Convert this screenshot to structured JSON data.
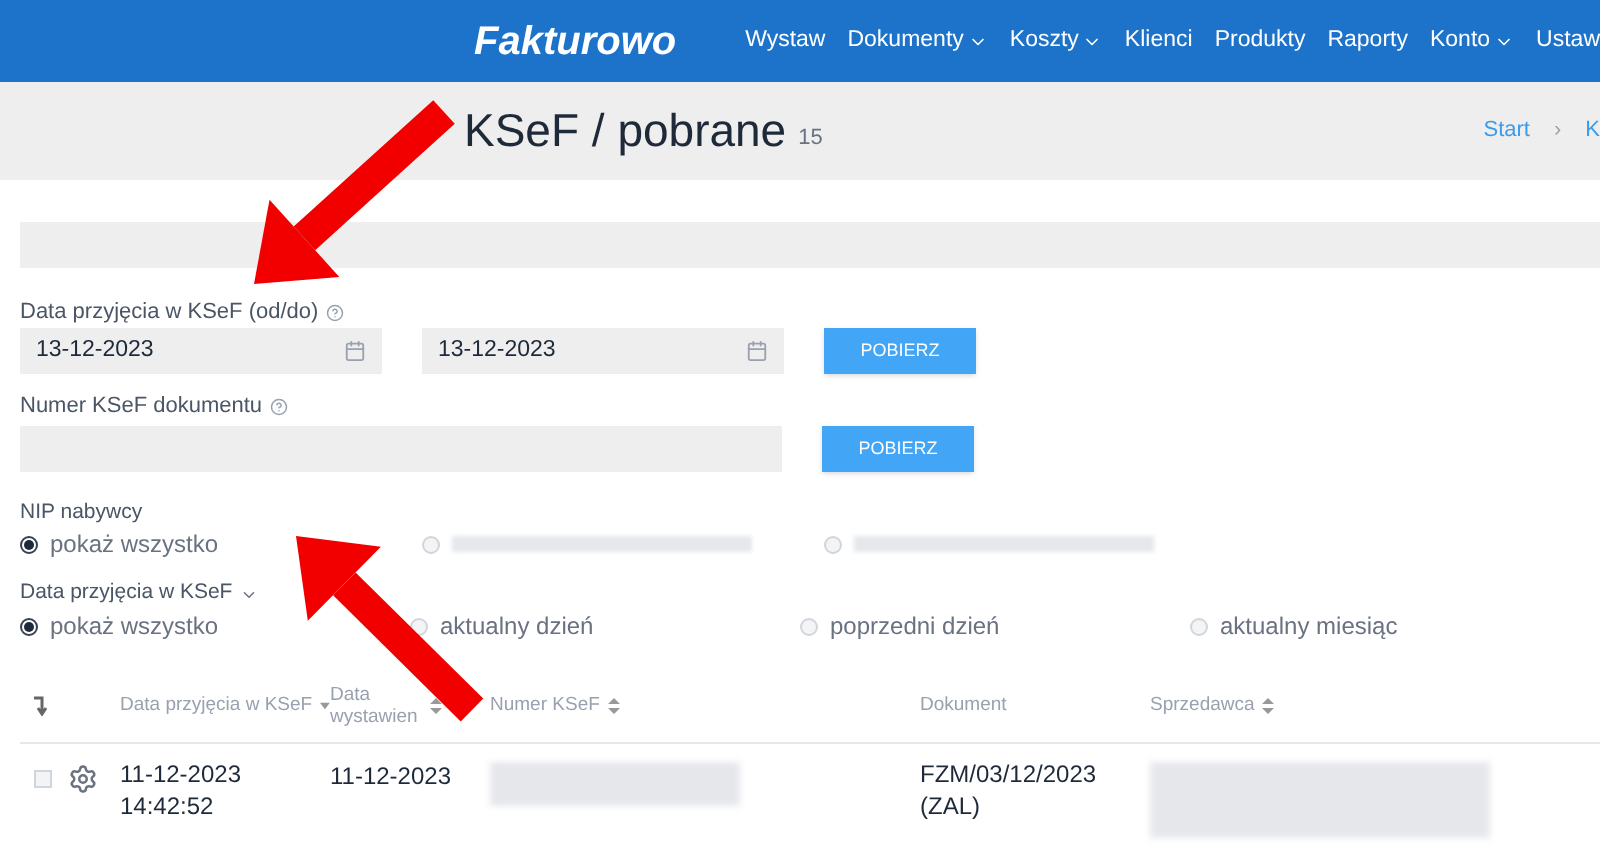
{
  "nav": {
    "logo": "Fakturowo",
    "items": [
      {
        "label": "Wystaw",
        "dropdown": false
      },
      {
        "label": "Dokumenty",
        "dropdown": true
      },
      {
        "label": "Koszty",
        "dropdown": true
      },
      {
        "label": "Klienci",
        "dropdown": false
      },
      {
        "label": "Produkty",
        "dropdown": false
      },
      {
        "label": "Raporty",
        "dropdown": false
      },
      {
        "label": "Konto",
        "dropdown": true
      },
      {
        "label": "Ustaw",
        "dropdown": false
      }
    ]
  },
  "header": {
    "title": "KSeF / pobrane",
    "count": "15",
    "breadcrumb": [
      "Start",
      "K"
    ],
    "breadcrumb_separator": "›"
  },
  "date_filter": {
    "label": "Data przyjęcia w KSeF (od/do)",
    "from": "13-12-2023",
    "to": "13-12-2023",
    "button": "POBIERZ"
  },
  "number_filter": {
    "label": "Numer KSeF dokumentu",
    "button": "POBIERZ"
  },
  "nip_filter": {
    "label": "NIP nabywcy",
    "options": [
      {
        "kind": "text",
        "label": "pokaż wszystko",
        "selected": true
      },
      {
        "kind": "blurred",
        "selected": false
      },
      {
        "kind": "blurred",
        "selected": false
      }
    ]
  },
  "date_range_filter": {
    "label": "Data przyjęcia w KSeF",
    "options": [
      {
        "kind": "text",
        "label": "pokaż wszystko",
        "selected": true
      },
      {
        "kind": "text",
        "label": "aktualny dzień",
        "selected": false
      },
      {
        "kind": "text",
        "label": "poprzedni dzień",
        "selected": false
      },
      {
        "kind": "text",
        "label": "aktualny miesiąc",
        "selected": false
      }
    ]
  },
  "table": {
    "columns": [
      {
        "label": "Data przyjęcia w KSeF",
        "kind": "descending"
      },
      {
        "label": "Data wystawien",
        "kind": "sortable"
      },
      {
        "label": "Numer KSeF",
        "kind": "sortable"
      },
      {
        "label": "Dokument",
        "kind": "plain"
      },
      {
        "label": "Sprzedawca",
        "kind": "sortable"
      }
    ],
    "rows": [
      {
        "checked": false,
        "received": "11-12-2023 14:42:52",
        "issued": "11-12-2023",
        "document": "FZM/03/12/2023 (ZAL)"
      }
    ]
  }
}
